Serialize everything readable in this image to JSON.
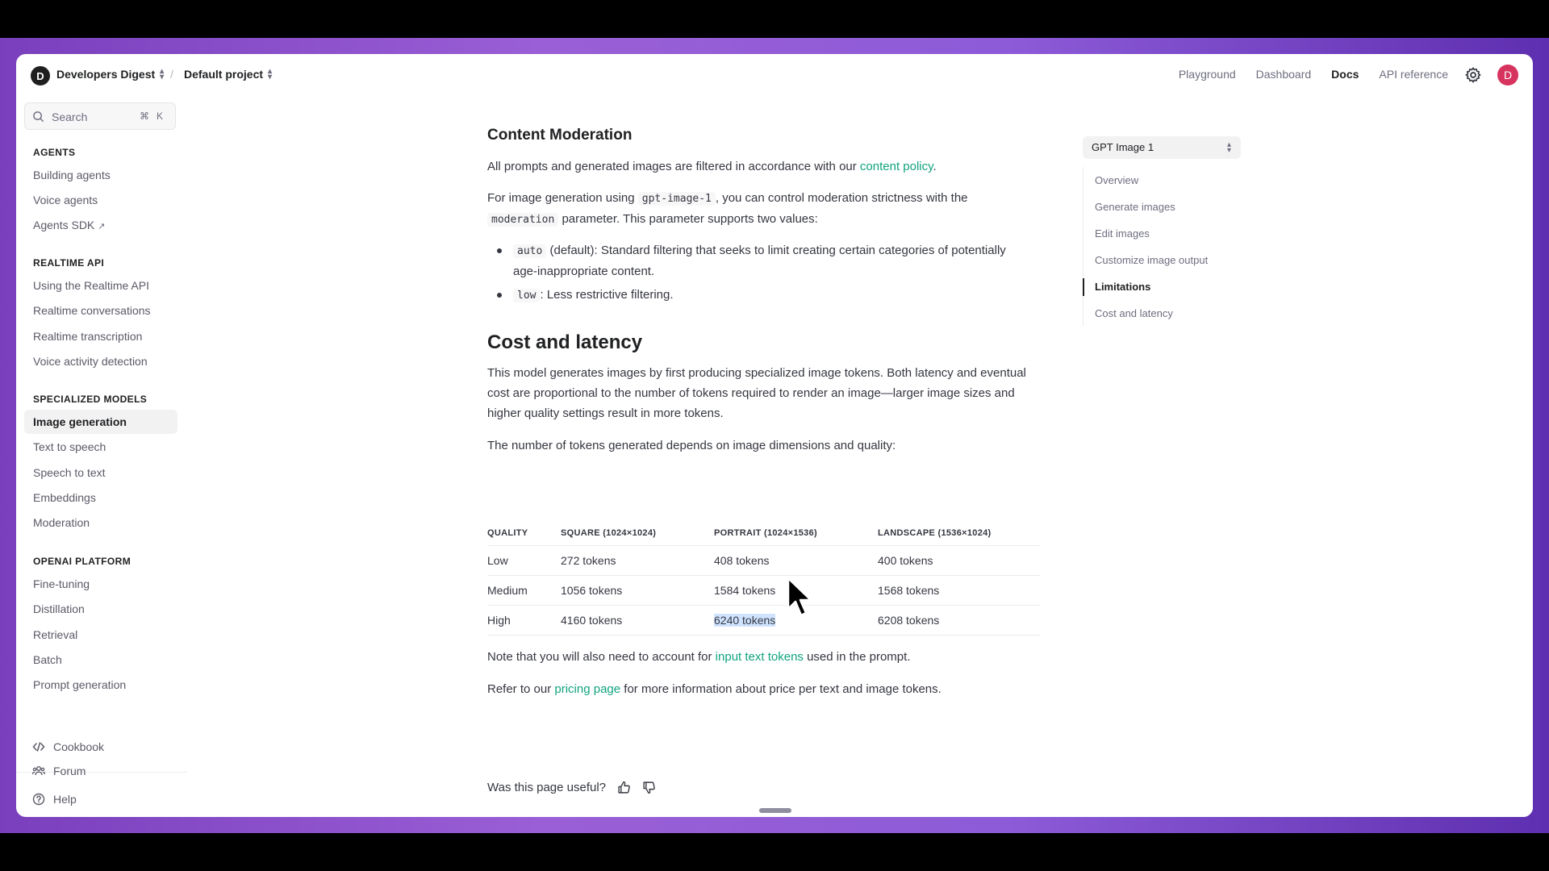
{
  "header": {
    "org_initial": "D",
    "org_name": "Developers Digest",
    "project_name": "Default project",
    "nav": [
      "Playground",
      "Dashboard",
      "Docs",
      "API reference"
    ],
    "active_nav": "Docs",
    "user_initial": "D"
  },
  "sidebar": {
    "search_placeholder": "Search",
    "shortcut_cmd": "⌘",
    "shortcut_key": "K",
    "sections": [
      {
        "title": "AGENTS",
        "items": [
          "Building agents",
          "Voice agents",
          "Agents SDK"
        ]
      },
      {
        "title": "REALTIME API",
        "items": [
          "Using the Realtime API",
          "Realtime conversations",
          "Realtime transcription",
          "Voice activity detection"
        ]
      },
      {
        "title": "SPECIALIZED MODELS",
        "items": [
          "Image generation",
          "Text to speech",
          "Speech to text",
          "Embeddings",
          "Moderation"
        ]
      },
      {
        "title": "OPENAI PLATFORM",
        "items": [
          "Fine-tuning",
          "Distillation",
          "Retrieval",
          "Batch",
          "Prompt generation"
        ]
      }
    ],
    "active_item": "Image generation",
    "footer": [
      "Cookbook",
      "Forum",
      "Help"
    ]
  },
  "content": {
    "moderation_heading": "Content Moderation",
    "mod_p1_a": "All prompts and generated images are filtered in accordance with our ",
    "mod_p1_link": "content policy",
    "mod_p1_b": ".",
    "mod_p2_a": "For image generation using ",
    "mod_p2_code1": "gpt-image-1",
    "mod_p2_b": ", you can control moderation strictness with the ",
    "mod_p2_code2": "moderation",
    "mod_p2_c": " parameter. This parameter supports two values:",
    "bullet1_code": "auto",
    "bullet1_text": " (default): Standard filtering that seeks to limit creating certain categories of potentially age-inappropriate content.",
    "bullet2_code": "low",
    "bullet2_text": ": Less restrictive filtering.",
    "cost_heading": "Cost and latency",
    "cost_p1": "This model generates images by first producing specialized image tokens. Both latency and eventual cost are proportional to the number of tokens required to render an image—larger image sizes and higher quality settings result in more tokens.",
    "cost_p2": "The number of tokens generated depends on image dimensions and quality:",
    "table": {
      "headers": [
        "QUALITY",
        "SQUARE (1024×1024)",
        "PORTRAIT (1024×1536)",
        "LANDSCAPE (1536×1024)"
      ],
      "rows": [
        [
          "Low",
          "272 tokens",
          "408 tokens",
          "400 tokens"
        ],
        [
          "Medium",
          "1056 tokens",
          "1584 tokens",
          "1568 tokens"
        ],
        [
          "High",
          "4160 tokens",
          "6240 tokens",
          "6208 tokens"
        ]
      ]
    },
    "note_a": "Note that you will also need to account for ",
    "note_link": "input text tokens",
    "note_b": " used in the prompt.",
    "refer_a": "Refer to our ",
    "refer_link": "pricing page",
    "refer_b": " for more information about price per text and image tokens.",
    "feedback_question": "Was this page useful?"
  },
  "toc": {
    "model_select": "GPT Image 1",
    "items": [
      "Overview",
      "Generate images",
      "Edit images",
      "Customize image output",
      "Limitations",
      "Cost and latency"
    ],
    "active": "Limitations"
  },
  "colors": {
    "link": "#10a37f",
    "selection": "#cfe3ff",
    "user_avatar": "#d6335e"
  }
}
